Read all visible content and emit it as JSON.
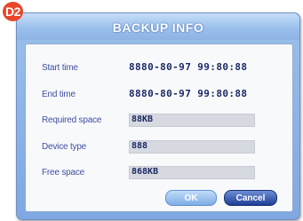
{
  "badge": "D2",
  "dialog": {
    "title": "BACKUP INFO",
    "fields": [
      {
        "label": "Start time",
        "value": "8880-80-97 99:80:88"
      },
      {
        "label": "End time",
        "value": "8880-80-97 99:80:88"
      },
      {
        "label": "Required space",
        "value": "88KB"
      },
      {
        "label": "Device type",
        "value": "888"
      },
      {
        "label": "Free space",
        "value": "868KB"
      }
    ],
    "ok_label": "OK",
    "cancel_label": "Cancel"
  },
  "colors": {
    "accent": "#7fa8e2",
    "label_text": "#3f4fa0",
    "value_text": "#1c2a66",
    "badge": "#e8452a"
  }
}
